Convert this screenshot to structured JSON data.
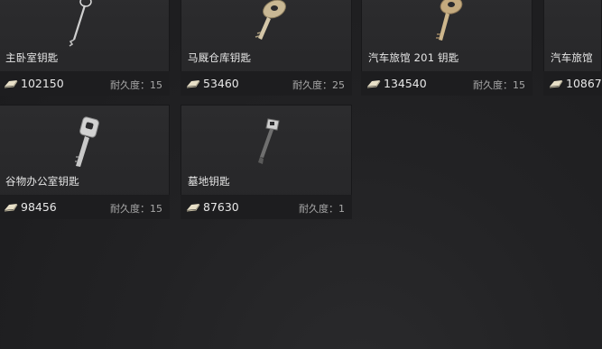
{
  "keys": [
    {
      "name": "主卧室钥匙",
      "price": "102150",
      "durability_label": "耐久度：",
      "durability": "15",
      "icon": "thin-key-icon"
    },
    {
      "name": "马厩仓库钥匙",
      "price": "53460",
      "durability_label": "耐久度：",
      "durability": "25",
      "icon": "brass-key-icon"
    },
    {
      "name": "汽车旅馆 201 钥匙",
      "price": "134540",
      "durability_label": "耐久度：",
      "durability": "15",
      "icon": "brass-key-icon"
    },
    {
      "name": "汽车旅馆",
      "price": "10867",
      "durability_label": "",
      "durability": "",
      "icon": "key-icon"
    },
    {
      "name": "谷物办公室钥匙",
      "price": "98456",
      "durability_label": "耐久度：",
      "durability": "15",
      "icon": "silver-key-icon"
    },
    {
      "name": "墓地钥匙",
      "price": "87630",
      "durability_label": "耐久度：",
      "durability": "1",
      "icon": "dark-key-icon"
    }
  ],
  "colors": {
    "background": "#1e1e20",
    "card": "#2a2a2c",
    "footer": "#1d1d1f",
    "text": "#e6e6e6",
    "muted": "#a8a8a8",
    "currency": "#e8e0c8"
  }
}
